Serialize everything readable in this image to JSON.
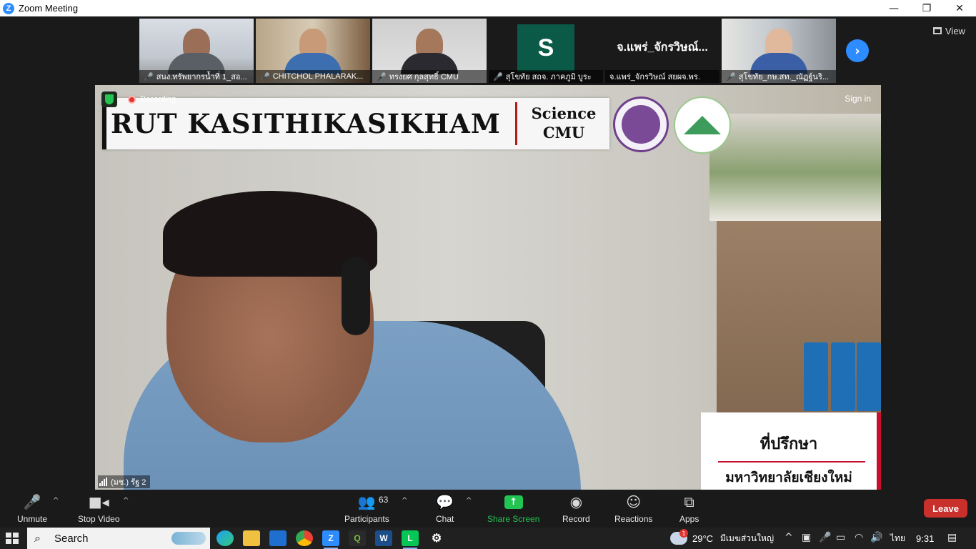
{
  "window": {
    "title": "Zoom Meeting",
    "minimize": "—",
    "maximize": "❐",
    "close": "✕"
  },
  "thumbnails": [
    {
      "name": "สนง.ทรัพยากรน้ำที่ 1_สอ..."
    },
    {
      "name": "CHITCHOL PHALARAK..."
    },
    {
      "name": "ทรงยศ กุลสุทธิ์ CMU"
    },
    {
      "name": "สุโขทัย สถจ. ภาคภูมิ บูระ",
      "avatar_letter": "S"
    },
    {
      "name": "จ.แพร่_จักรวิษณ์ สยผจ.พร.",
      "display_name": "จ.แพร่_จักรวิษณ์..."
    },
    {
      "name": "สุโขทัย_กษ.สท._ณัฏฐ์นริ..."
    }
  ],
  "view_label": "View",
  "main_video": {
    "recording_label": "Recording",
    "sign_in": "Sign in",
    "banner_name": "RUT KASITHIKASIKHAM",
    "banner_science": "Science",
    "banner_cmu": "CMU",
    "advisor_title": "ที่ปรึกษา",
    "advisor_university": "มหาวิทยาลัยเชียงใหม่",
    "speaker_label": "(มช.) รัฐ 2"
  },
  "toolbar": {
    "unmute": "Unmute",
    "stop_video": "Stop Video",
    "participants": "Participants",
    "participants_count": "63",
    "chat": "Chat",
    "share_screen": "Share Screen",
    "record": "Record",
    "reactions": "Reactions",
    "apps": "Apps",
    "leave": "Leave"
  },
  "taskbar": {
    "search_text": "Search",
    "weather_temp": "29°C",
    "weather_desc": "มีเมฆส่วนใหญ่",
    "weather_badge": "1",
    "language": "ไทย",
    "time": "9:31"
  },
  "colors": {
    "zoom_blue": "#2d8cff",
    "share_green": "#23c552",
    "leave_red": "#c9302c",
    "background": "#1a1a1a"
  }
}
